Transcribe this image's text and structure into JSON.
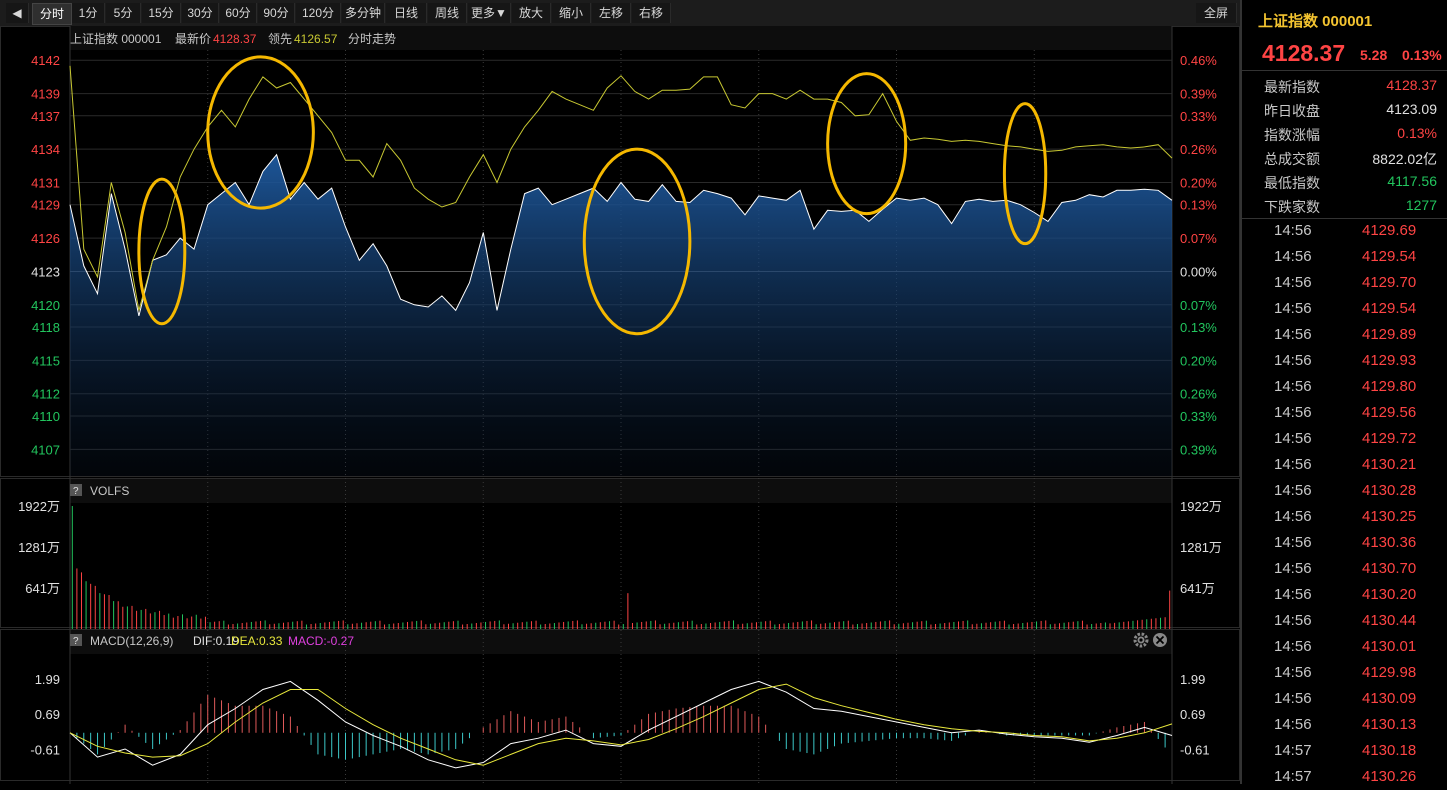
{
  "toolbar": {
    "collapse_icon": "panel-collapse-icon",
    "buttons": [
      "分时",
      "1分",
      "5分",
      "15分",
      "30分",
      "60分",
      "90分",
      "120分",
      "多分钟",
      "日线",
      "周线",
      "更多▼",
      "放大",
      "缩小",
      "左移",
      "右移"
    ],
    "fullscreen": "全屏"
  },
  "main_header": {
    "name": "上证指数 000001",
    "latest_label": "最新价",
    "latest_value": "4128.37",
    "lead_label": "领先",
    "lead_value": "4126.57",
    "trend_label": "分时走势"
  },
  "volume_header": {
    "help": "?",
    "label": "VOLFS"
  },
  "macd_header": {
    "help": "?",
    "label": "MACD(12,26,9)",
    "dif": "DIF:0.19",
    "dea": "DEA:0.33",
    "macd": "MACD:-0.27",
    "gear_icon": "gear-icon",
    "close_icon": "close-icon"
  },
  "side": {
    "title": "上证指数 000001",
    "price": "4128.37",
    "change": "5.28",
    "change_pct": "0.13%",
    "stats": [
      {
        "label": "最新指数",
        "value": "4128.37",
        "color": "#ff4444"
      },
      {
        "label": "昨日收盘",
        "value": "4123.09",
        "color": "#e0e0e0"
      },
      {
        "label": "指数涨幅",
        "value": "0.13%",
        "color": "#ff4444"
      },
      {
        "label": "总成交额",
        "value": "8822.02亿",
        "color": "#e0e0e0"
      },
      {
        "label": "最低指数",
        "value": "4117.56",
        "color": "#22c55e"
      },
      {
        "label": "下跌家数",
        "value": "1277",
        "color": "#22c55e"
      }
    ],
    "ticks": [
      {
        "time": "14:56",
        "price": "4129.69"
      },
      {
        "time": "14:56",
        "price": "4129.54"
      },
      {
        "time": "14:56",
        "price": "4129.70"
      },
      {
        "time": "14:56",
        "price": "4129.54"
      },
      {
        "time": "14:56",
        "price": "4129.89"
      },
      {
        "time": "14:56",
        "price": "4129.93"
      },
      {
        "time": "14:56",
        "price": "4129.80"
      },
      {
        "time": "14:56",
        "price": "4129.56"
      },
      {
        "time": "14:56",
        "price": "4129.72"
      },
      {
        "time": "14:56",
        "price": "4130.21"
      },
      {
        "time": "14:56",
        "price": "4130.28"
      },
      {
        "time": "14:56",
        "price": "4130.25"
      },
      {
        "time": "14:56",
        "price": "4130.36"
      },
      {
        "time": "14:56",
        "price": "4130.70"
      },
      {
        "time": "14:56",
        "price": "4130.20"
      },
      {
        "time": "14:56",
        "price": "4130.44"
      },
      {
        "time": "14:56",
        "price": "4130.01"
      },
      {
        "time": "14:56",
        "price": "4129.98"
      },
      {
        "time": "14:56",
        "price": "4130.09"
      },
      {
        "time": "14:56",
        "price": "4130.13"
      },
      {
        "time": "14:57",
        "price": "4130.18"
      },
      {
        "time": "14:57",
        "price": "4130.26"
      }
    ]
  },
  "colors": {
    "up": "#ff4444",
    "down": "#22c55e",
    "price_line": "#ffffff",
    "lead_line": "#c8c832",
    "area": "#1e5aa0",
    "highlight": "#f5b800",
    "macd_hist_pos": "#e05a5a",
    "macd_hist_neg": "#3cc8c8",
    "dif": "#ffffff",
    "dea": "#e8e83c"
  },
  "chart_data": [
    {
      "type": "line",
      "title": "分时走势",
      "prev_close": 4123.09,
      "ylim": [
        4105.5,
        4142.2
      ],
      "y_ticks_left": [
        {
          "v": 4142,
          "label": "4142",
          "c": "up"
        },
        {
          "v": 4139,
          "label": "4139",
          "c": "up"
        },
        {
          "v": 4137,
          "label": "4137",
          "c": "up"
        },
        {
          "v": 4134,
          "label": "4134",
          "c": "up"
        },
        {
          "v": 4131,
          "label": "4131",
          "c": "up"
        },
        {
          "v": 4129,
          "label": "4129",
          "c": "up"
        },
        {
          "v": 4126,
          "label": "4126",
          "c": "up"
        },
        {
          "v": 4123,
          "label": "4123",
          "c": "flat"
        },
        {
          "v": 4120,
          "label": "4120",
          "c": "down"
        },
        {
          "v": 4118,
          "label": "4118",
          "c": "down"
        },
        {
          "v": 4115,
          "label": "4115",
          "c": "down"
        },
        {
          "v": 4112,
          "label": "4112",
          "c": "down"
        },
        {
          "v": 4110,
          "label": "4110",
          "c": "down"
        },
        {
          "v": 4107,
          "label": "4107",
          "c": "down"
        }
      ],
      "y_ticks_right": [
        "0.46%",
        "0.39%",
        "0.33%",
        "0.26%",
        "0.20%",
        "0.13%",
        "0.07%",
        "0.00%",
        "0.07%",
        "0.13%",
        "0.20%",
        "0.26%",
        "0.33%",
        "0.39%"
      ],
      "series": [
        {
          "key": "price",
          "x": [
            0,
            3,
            6,
            9,
            12,
            15,
            18,
            21,
            24,
            27,
            30,
            33,
            36,
            39,
            42,
            45,
            48,
            51,
            54,
            57,
            60,
            63,
            66,
            69,
            72,
            75,
            78,
            81,
            84,
            87,
            90,
            93,
            96,
            99,
            102,
            105,
            108,
            111,
            114,
            117,
            120,
            123,
            126,
            129,
            132,
            135,
            138,
            141,
            144,
            147,
            150,
            153,
            156,
            159,
            162,
            165,
            168,
            171,
            174,
            177,
            180,
            183,
            186,
            189,
            192,
            195,
            198,
            201,
            204,
            207,
            210,
            213,
            216,
            219,
            222,
            225,
            228,
            231,
            234,
            237,
            240
          ],
          "y": [
            4129,
            4123.5,
            4121,
            4130,
            4125,
            4119,
            4124,
            4124.5,
            4126,
            4125,
            4129,
            4130,
            4131,
            4129,
            4132,
            4133.5,
            4129.5,
            4131,
            4129.5,
            4130.5,
            4127,
            4124,
            4125.5,
            4123.5,
            4120.5,
            4120,
            4119.8,
            4120.8,
            4119.5,
            4122,
            4126.5,
            4119.5,
            4125,
            4130,
            4130.5,
            4129,
            4129.5,
            4130,
            4130.5,
            4129.3,
            4131,
            4129.5,
            4129.3,
            4130.8,
            4129.3,
            4129.2,
            4130.3,
            4130,
            4129.6,
            4128.1,
            4129.8,
            4129.6,
            4129.4,
            4130.3,
            4126.8,
            4128.5,
            4128.4,
            4128.5,
            4127.5,
            4128.6,
            4129.6,
            4129.4,
            4129.6,
            4129,
            4127.3,
            4129.3,
            4129.5,
            4129.3,
            4129.4,
            4129,
            4128.3,
            4127.5,
            4129.2,
            4129.4,
            4129.9,
            4129.7,
            4130.3,
            4130.3,
            4130.4,
            4130.3,
            4129.4
          ]
        },
        {
          "key": "lead",
          "x": [
            0,
            3,
            6,
            9,
            12,
            15,
            18,
            21,
            24,
            27,
            30,
            33,
            36,
            39,
            42,
            45,
            48,
            51,
            54,
            57,
            60,
            63,
            66,
            69,
            72,
            75,
            78,
            81,
            84,
            87,
            90,
            93,
            96,
            99,
            102,
            105,
            108,
            111,
            114,
            117,
            120,
            123,
            126,
            129,
            132,
            135,
            138,
            141,
            144,
            147,
            150,
            153,
            156,
            159,
            162,
            165,
            168,
            171,
            174,
            177,
            180,
            183,
            186,
            189,
            192,
            195,
            198,
            201,
            204,
            207,
            210,
            213,
            216,
            219,
            222,
            225,
            228,
            231,
            234,
            237,
            240
          ],
          "y": [
            4141.5,
            4125,
            4122.5,
            4131,
            4126.5,
            4119.5,
            4124,
            4127,
            4131.5,
            4134,
            4136,
            4137.5,
            4136,
            4138.5,
            4140.5,
            4139.5,
            4140,
            4138.5,
            4137,
            4135.5,
            4133,
            4133,
            4131.5,
            4134.5,
            4133,
            4130.5,
            4129.5,
            4128.8,
            4129.2,
            4131.5,
            4133.5,
            4131,
            4134,
            4136,
            4137.5,
            4139.2,
            4138.5,
            4138,
            4137.5,
            4139.5,
            4140.6,
            4139.2,
            4138.5,
            4139.3,
            4139.3,
            4139.4,
            4140.5,
            4140.5,
            4138,
            4137.7,
            4139,
            4139,
            4138.5,
            4139.3,
            4138.5,
            4138.5,
            4138.2,
            4137,
            4137.1,
            4139,
            4136.5,
            4134.8,
            4135,
            4134.9,
            4134.7,
            4134.8,
            4134.7,
            4134.5,
            4134.3,
            4134.2,
            4134,
            4133.8,
            4133.9,
            4134.2,
            4134.3,
            4134.4,
            4134.2,
            4134.1,
            4134.2,
            4134.4,
            4133.2
          ]
        }
      ],
      "highlights": [
        {
          "cx": 20,
          "cy": 4124.8,
          "rx": 5,
          "ry": 6.5
        },
        {
          "cx": 41.5,
          "cy": 4135.5,
          "rx": 11.5,
          "ry": 6.8
        },
        {
          "cx": 123.5,
          "cy": 4125.7,
          "rx": 11.5,
          "ry": 8.3
        },
        {
          "cx": 173.5,
          "cy": 4134.5,
          "rx": 8.5,
          "ry": 6.3
        },
        {
          "cx": 208,
          "cy": 4131.8,
          "rx": 4.5,
          "ry": 6.3
        }
      ]
    },
    {
      "type": "bar",
      "title": "VOLFS",
      "y_ticks": [
        {
          "v": 1922,
          "label": "1922万"
        },
        {
          "v": 1281,
          "label": "1281万"
        },
        {
          "v": 641,
          "label": "641万"
        }
      ],
      "ylim": [
        0,
        1922
      ]
    },
    {
      "type": "bar",
      "title": "MACD(12,26,9)",
      "y_ticks": [
        {
          "v": 1.99,
          "label": "1.99"
        },
        {
          "v": 0.69,
          "label": "0.69"
        },
        {
          "v": -0.61,
          "label": "-0.61"
        }
      ],
      "ylim": [
        -1.6,
        1.99
      ],
      "dif": {
        "x": [
          0,
          6,
          12,
          18,
          24,
          30,
          36,
          42,
          48,
          54,
          60,
          66,
          72,
          78,
          84,
          90,
          96,
          102,
          108,
          114,
          120,
          126,
          132,
          138,
          144,
          150,
          156,
          162,
          168,
          174,
          180,
          186,
          192,
          198,
          204,
          210,
          216,
          222,
          228,
          234,
          240
        ],
        "y": [
          0,
          -0.9,
          -0.6,
          -1.2,
          -0.8,
          0.3,
          0.9,
          1.6,
          1.9,
          1.2,
          0.4,
          -0.1,
          -0.5,
          -1.0,
          -1.3,
          -1.1,
          -0.4,
          -0.2,
          0.1,
          -0.4,
          -0.5,
          0.1,
          0.6,
          1.1,
          1.6,
          1.9,
          1.5,
          0.9,
          0.8,
          0.6,
          0.4,
          0.2,
          0.0,
          0.1,
          -0.05,
          -0.15,
          -0.2,
          -0.35,
          -0.1,
          0.2,
          -0.1
        ]
      },
      "dea": {
        "x": [
          0,
          6,
          12,
          18,
          24,
          30,
          36,
          42,
          48,
          54,
          60,
          66,
          72,
          78,
          84,
          90,
          96,
          102,
          108,
          114,
          120,
          126,
          132,
          138,
          144,
          150,
          156,
          162,
          168,
          174,
          180,
          186,
          192,
          198,
          204,
          210,
          216,
          222,
          228,
          234,
          240
        ],
        "y": [
          0,
          -0.5,
          -0.75,
          -0.9,
          -0.85,
          -0.4,
          0.4,
          1.1,
          1.6,
          1.6,
          0.9,
          0.3,
          -0.2,
          -0.6,
          -1.0,
          -1.2,
          -0.8,
          -0.4,
          -0.2,
          -0.3,
          -0.45,
          -0.25,
          0.15,
          0.6,
          1.1,
          1.6,
          1.8,
          1.3,
          1.0,
          0.75,
          0.5,
          0.3,
          0.15,
          0.05,
          0.0,
          -0.1,
          -0.15,
          -0.3,
          -0.2,
          0.0,
          0.33
        ]
      }
    }
  ]
}
